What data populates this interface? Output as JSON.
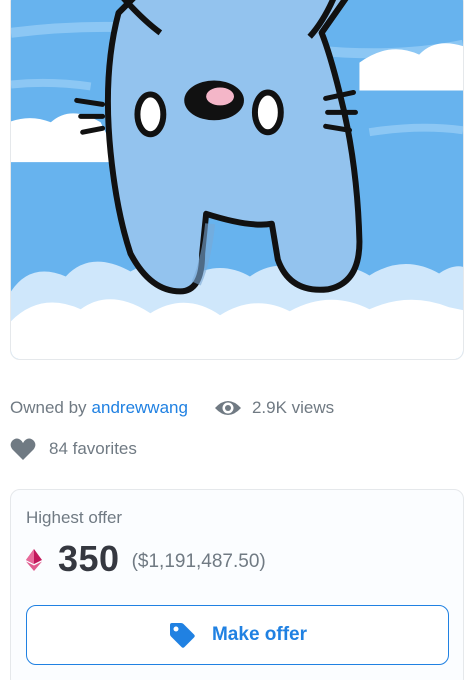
{
  "artwork": {
    "icon": "nft-artwork-blue-cat-on-clouds"
  },
  "ownership": {
    "owned_by_label": "Owned by",
    "owner_name": "andrewwang",
    "views": "2.9K views",
    "views_icon": "eye-icon"
  },
  "favorites": {
    "label": "84 favorites",
    "icon": "heart-icon"
  },
  "offer": {
    "label": "Highest offer",
    "currency_icon": "ethereum-icon",
    "price": "350",
    "price_usd": "($1,191,487.50)",
    "button_label": "Make offer",
    "button_icon": "tag-icon"
  },
  "colors": {
    "accent": "#2081e2",
    "text": "#353840",
    "muted": "#707a83",
    "eth": "#c2185b",
    "border": "#e5e8eb"
  }
}
